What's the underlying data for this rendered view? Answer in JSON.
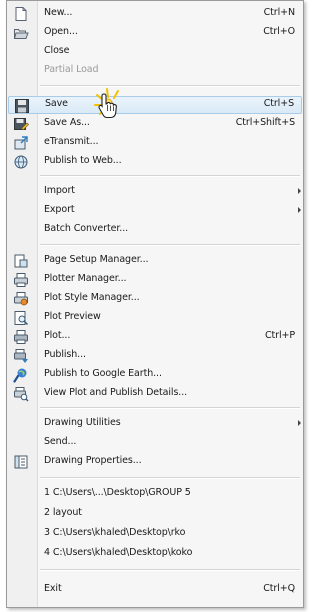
{
  "menu": {
    "items": [
      {
        "label": "New...",
        "shortcut": "Ctrl+N",
        "icon": "new-file-icon"
      },
      {
        "label": "Open...",
        "shortcut": "Ctrl+O",
        "icon": "open-folder-icon"
      },
      {
        "label": "Close",
        "shortcut": ""
      },
      {
        "label": "Partial Load",
        "shortcut": "",
        "disabled": true
      },
      {
        "label": "Save",
        "shortcut": "Ctrl+S",
        "icon": "save-icon",
        "highlighted": true
      },
      {
        "label": "Save As...",
        "shortcut": "Ctrl+Shift+S",
        "icon": "save-as-icon"
      },
      {
        "label": "eTransmit...",
        "shortcut": "",
        "icon": "etransmit-icon"
      },
      {
        "label": "Publish to Web...",
        "shortcut": "",
        "icon": "publish-web-icon"
      },
      {
        "label": "Import",
        "shortcut": "",
        "submenu": true
      },
      {
        "label": "Export",
        "shortcut": "",
        "submenu": true
      },
      {
        "label": "Batch Converter...",
        "shortcut": ""
      },
      {
        "label": "Page Setup Manager...",
        "shortcut": "",
        "icon": "page-setup-icon"
      },
      {
        "label": "Plotter Manager...",
        "shortcut": "",
        "icon": "plotter-manager-icon"
      },
      {
        "label": "Plot Style Manager...",
        "shortcut": "",
        "icon": "plot-style-icon"
      },
      {
        "label": "Plot Preview",
        "shortcut": "",
        "icon": "plot-preview-icon"
      },
      {
        "label": "Plot...",
        "shortcut": "Ctrl+P",
        "icon": "plot-icon"
      },
      {
        "label": "Publish...",
        "shortcut": "",
        "icon": "publish-icon"
      },
      {
        "label": "Publish to Google Earth...",
        "shortcut": "",
        "icon": "google-earth-icon"
      },
      {
        "label": "View Plot and Publish Details...",
        "shortcut": "",
        "icon": "plot-details-icon"
      },
      {
        "label": "Drawing Utilities",
        "shortcut": "",
        "submenu": true
      },
      {
        "label": "Send...",
        "shortcut": ""
      },
      {
        "label": "Drawing Properties...",
        "shortcut": "",
        "icon": "drawing-properties-icon"
      },
      {
        "label": "1 C:\\Users\\...\\Desktop\\GROUP 5",
        "shortcut": ""
      },
      {
        "label": "2 layout",
        "shortcut": ""
      },
      {
        "label": "3 C:\\Users\\khaled\\Desktop\\rko",
        "shortcut": ""
      },
      {
        "label": "4 C:\\Users\\khaled\\Desktop\\koko",
        "shortcut": ""
      },
      {
        "label": "Exit",
        "shortcut": "Ctrl+Q"
      }
    ]
  },
  "colors": {
    "highlight_bg": "#d9eaf7",
    "highlight_border": "#a9cbe8",
    "disabled_text": "#9a9a9a"
  }
}
